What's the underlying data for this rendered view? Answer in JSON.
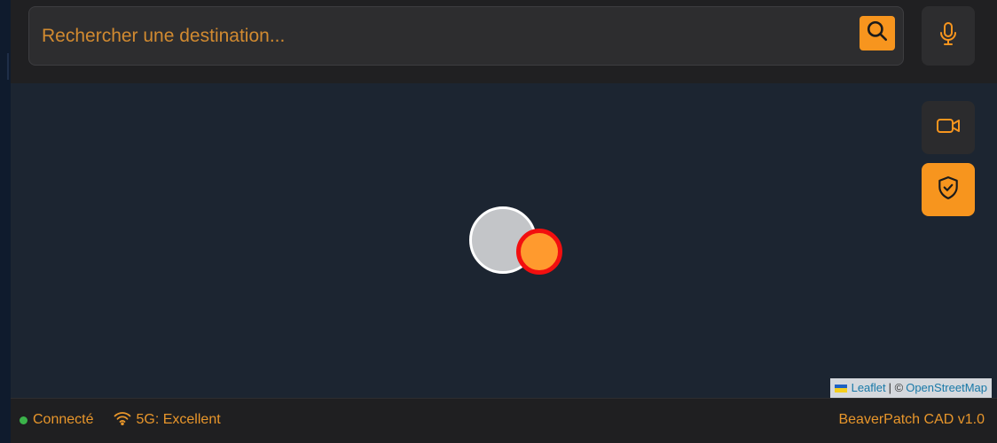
{
  "search": {
    "placeholder": "Rechercher une destination..."
  },
  "icons": {
    "search": "search-icon",
    "microphone": "microphone-icon",
    "video": "video-camera-icon",
    "shield": "shield-check-icon",
    "wifi": "wifi-icon"
  },
  "map": {
    "attribution": {
      "leaflet_label": "Leaflet",
      "separator": "| ©",
      "osm_label": "OpenStreetMap"
    }
  },
  "status": {
    "connection": "Connecté",
    "network": "5G: Excellent",
    "app_version": "BeaverPatch CAD v1.0"
  },
  "colors": {
    "accent": "#f7951e",
    "connected": "#3bb34a",
    "marker_border": "#f20f0f"
  }
}
